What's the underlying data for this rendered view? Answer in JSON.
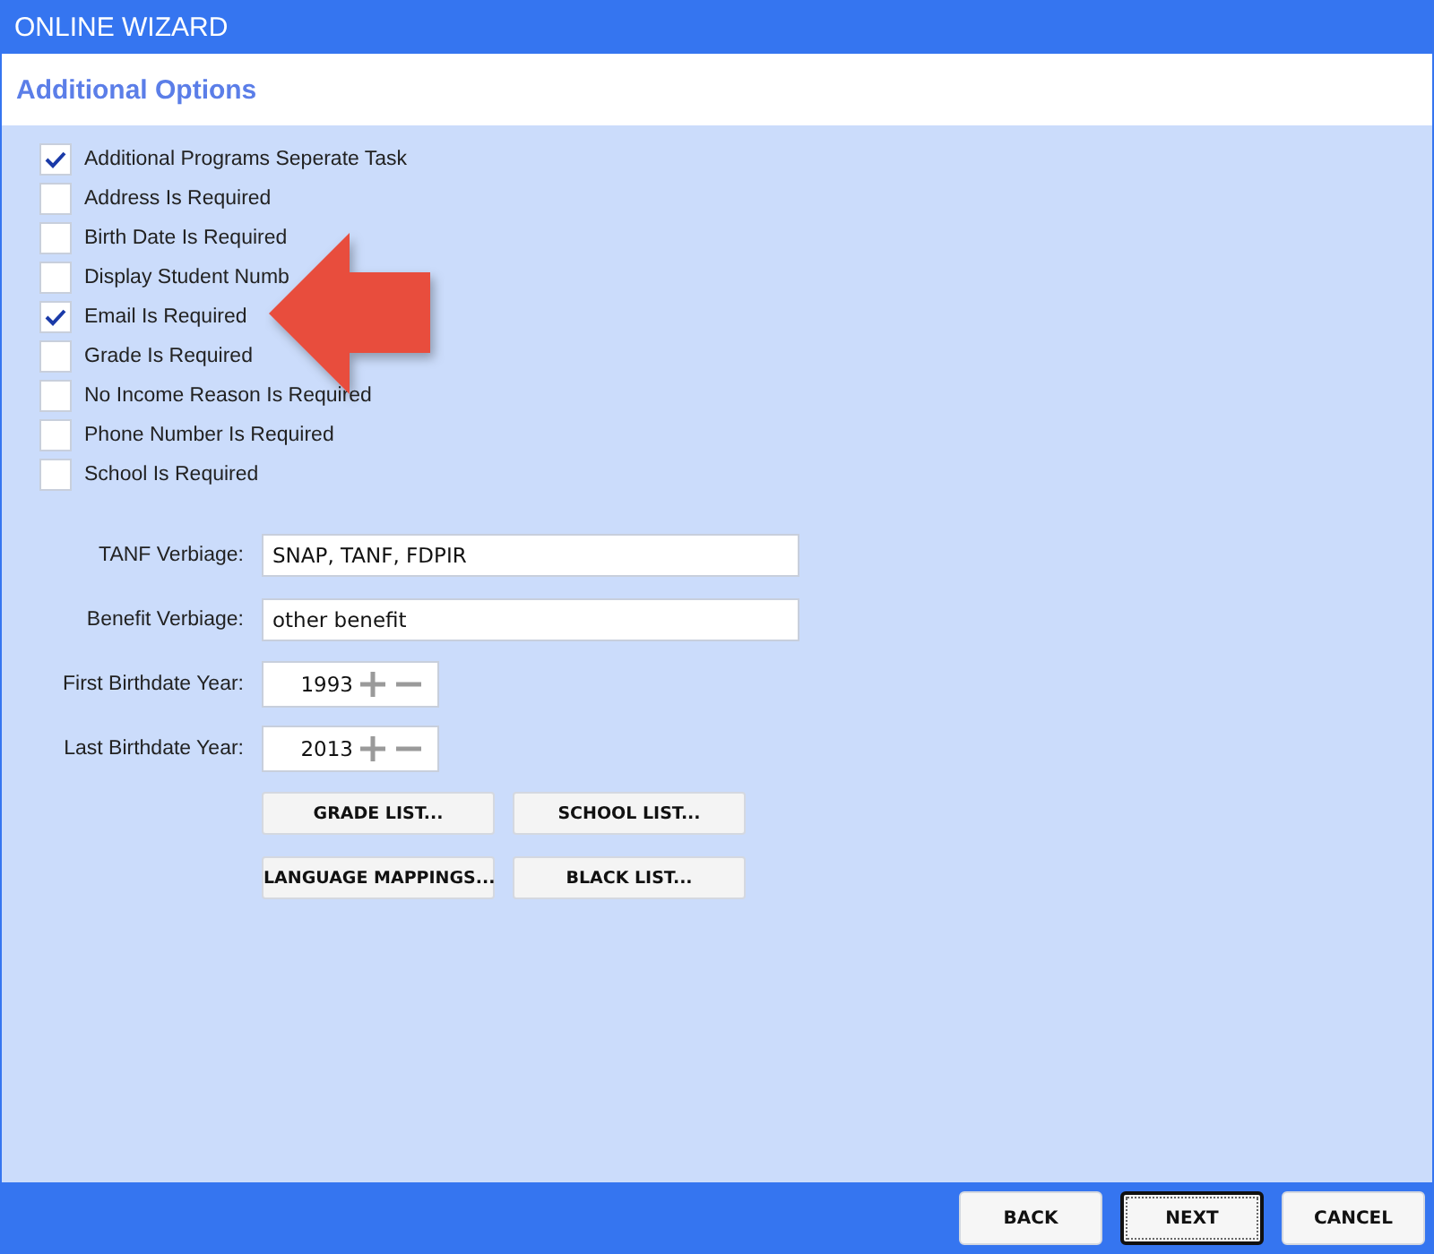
{
  "window": {
    "title": "ONLINE WIZARD"
  },
  "header": {
    "title": "Additional Options"
  },
  "options": [
    {
      "label": "Additional Programs Seperate Task",
      "checked": true
    },
    {
      "label": "Address Is Required",
      "checked": false
    },
    {
      "label": "Birth Date Is Required",
      "checked": false
    },
    {
      "label": "Display Student Numb",
      "checked": false
    },
    {
      "label": "Email Is Required",
      "checked": true
    },
    {
      "label": "Grade Is Required",
      "checked": false
    },
    {
      "label": "No Income Reason Is Required",
      "checked": false
    },
    {
      "label": "Phone Number Is Required",
      "checked": false
    },
    {
      "label": "School Is Required",
      "checked": false
    }
  ],
  "fields": [
    {
      "kind": "text",
      "label": "TANF Verbiage:",
      "value": "SNAP, TANF, FDPIR"
    },
    {
      "kind": "text",
      "label": "Benefit Verbiage:",
      "value": "other benefit"
    },
    {
      "kind": "spinner",
      "label": "First Birthdate Year:",
      "value": "1993"
    },
    {
      "kind": "spinner",
      "label": "Last Birthdate Year:",
      "value": "2013"
    }
  ],
  "list_buttons": [
    "GRADE LIST...",
    "SCHOOL LIST...",
    "LANGUAGE MAPPINGS...",
    "BLACK LIST..."
  ],
  "footer_buttons": [
    {
      "label": "BACK",
      "focused": false
    },
    {
      "label": "NEXT",
      "focused": true
    },
    {
      "label": "CANCEL",
      "focused": false
    }
  ]
}
